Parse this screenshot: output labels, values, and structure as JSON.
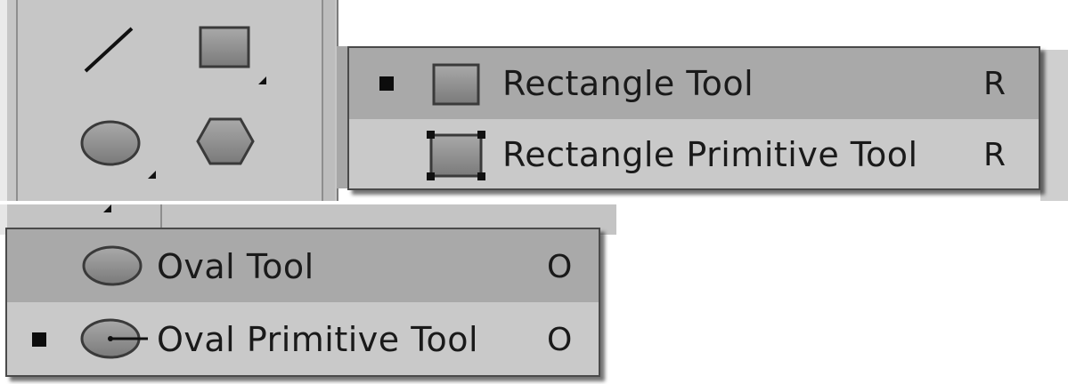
{
  "toolbox": {
    "tools": [
      {
        "name": "line",
        "icon": "line-tool-icon"
      },
      {
        "name": "rectangle",
        "icon": "rectangle-tool-icon",
        "has_flyout": true
      },
      {
        "name": "oval",
        "icon": "oval-tool-icon",
        "has_flyout": true
      },
      {
        "name": "polystar",
        "icon": "hexagon-tool-icon"
      }
    ]
  },
  "rectangle_menu": {
    "items": [
      {
        "label": "Rectangle Tool",
        "shortcut": "R",
        "active": true,
        "highlighted": true,
        "icon": "rectangle-icon"
      },
      {
        "label": "Rectangle Primitive Tool",
        "shortcut": "R",
        "active": false,
        "highlighted": false,
        "icon": "rectangle-primitive-icon"
      }
    ]
  },
  "oval_menu": {
    "items": [
      {
        "label": "Oval Tool",
        "shortcut": "O",
        "active": false,
        "highlighted": true,
        "icon": "oval-icon"
      },
      {
        "label": "Oval Primitive Tool",
        "shortcut": "O",
        "active": true,
        "highlighted": false,
        "icon": "oval-primitive-icon"
      }
    ]
  },
  "colors": {
    "panel": "#c6c6c6",
    "menu": "#c9c9c9",
    "highlight": "#a9a9a9",
    "icon_fill": "#8a8a8a",
    "icon_stroke": "#3a3a3a"
  }
}
